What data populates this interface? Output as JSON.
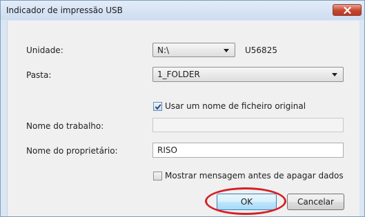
{
  "window": {
    "title": "Indicador de impressão USB",
    "close_icon": "close-icon"
  },
  "form": {
    "unidade_label": "Unidade:",
    "unidade_value": "N:\\",
    "unidade_id": "U56825",
    "pasta_label": "Pasta:",
    "pasta_value": "1_FOLDER",
    "use_original_name_label": "Usar um nome de ficheiro original",
    "use_original_name_checked": true,
    "job_name_label": "Nome do trabalho:",
    "job_name_value": "",
    "owner_label": "Nome do proprietário:",
    "owner_value": "RISO",
    "show_message_label": "Mostrar mensagem antes de apagar dados",
    "show_message_checked": false
  },
  "buttons": {
    "ok_label": "OK",
    "cancel_label": "Cancelar"
  },
  "colors": {
    "highlight_ring": "#d42027",
    "close_button": "#c7452f"
  }
}
